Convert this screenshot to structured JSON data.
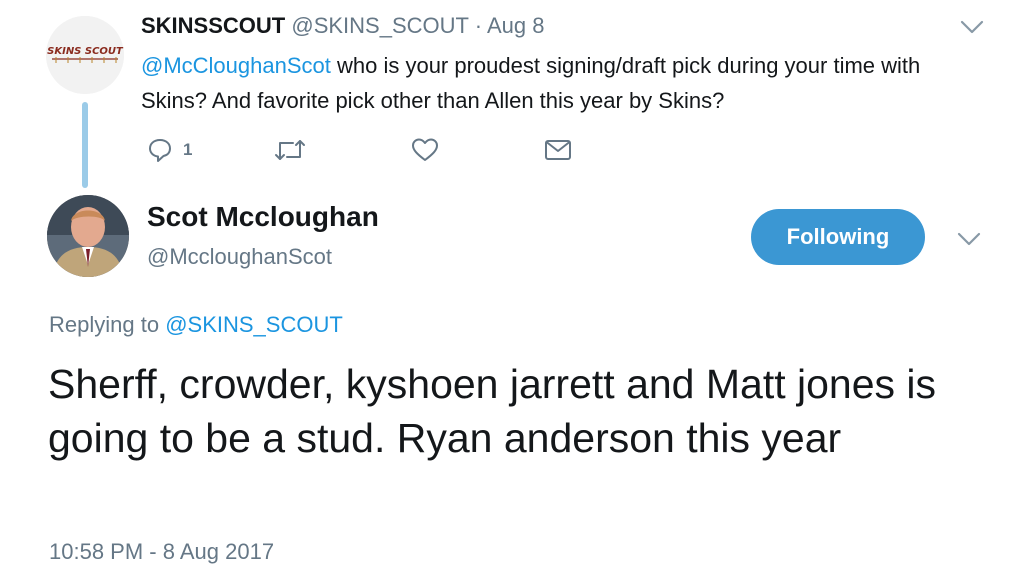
{
  "parent_tweet": {
    "avatar_text": "SKINS SCOUT",
    "display_name": "SKINSSCOUT",
    "handle": "@SKINS_SCOUT",
    "separator": "·",
    "date": "Aug 8",
    "text_mention": "@McCloughanScot",
    "text_line1": " who is your proudest signing/draft pick during your time with",
    "text_line2": "Skins? And favorite pick other than Allen this year by Skins?",
    "reply_count": "1",
    "icons": [
      "reply-icon",
      "retweet-icon",
      "like-icon",
      "message-icon",
      "chevron-down-icon"
    ]
  },
  "main_tweet": {
    "display_name": "Scot Mccloughan",
    "handle": "@MccloughanScot",
    "follow_label": "Following",
    "replying_prefix": "Replying to ",
    "replying_to": "@SKINS_SCOUT",
    "text": "Sherff, crowder, kyshoen jarrett and Matt jones is going to be a stud.  Ryan anderson this year",
    "timestamp": "10:58 PM - 8 Aug 2017"
  },
  "colors": {
    "link_blue": "#1b95e0",
    "follow_button": "#3b97d3",
    "thread_line": "#9bcbe8",
    "secondary_text": "#657786"
  }
}
